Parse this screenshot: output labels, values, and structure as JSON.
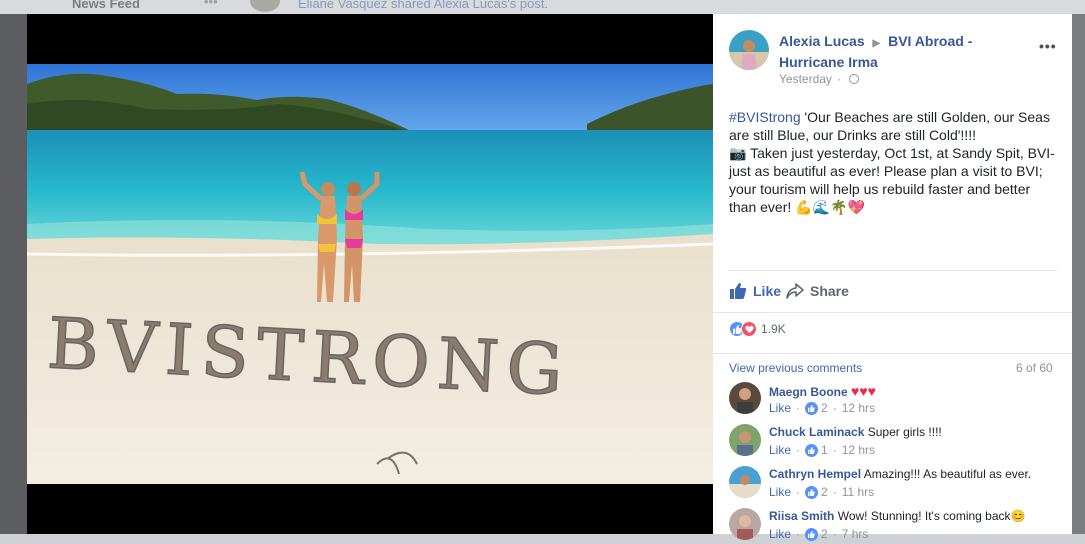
{
  "background": {
    "nav_label": "News Feed",
    "shared_text": "Eliane Vasquez shared Alexia Lucas's post."
  },
  "photo": {
    "sand_text": "BVISTRONG",
    "colors": {
      "sky": "#3f86e0",
      "sea": "#26b6c9",
      "sand": "#efe6d6"
    }
  },
  "post": {
    "author": "Alexia Lucas",
    "group": "BVI Abroad - Hurricane Irma",
    "time": "Yesterday",
    "hashtag": "#BVIStrong",
    "body_1": " 'Our Beaches are still Golden, our Seas are still Blue, our Drinks are still Cold'!!!!",
    "body_2": "📷 Taken just yesterday, Oct 1st, at Sandy Spit, BVI- just as beautiful as ever! Please plan a visit to BVI; your tourism will help us rebuild faster and better than ever! 💪🌊🌴💖",
    "more_label": "•••",
    "like_label": "Like",
    "share_label": "Share",
    "reaction_count": "1.9K"
  },
  "comments_section": {
    "view_previous": "View previous comments",
    "count": "6 of 60",
    "items": [
      {
        "name": "Maegn Boone",
        "text": "",
        "hearts": "♥♥♥",
        "like": "Like",
        "likes": "2",
        "time": "12 hrs"
      },
      {
        "name": "Chuck Laminack",
        "text": "Super girls !!!!",
        "hearts": "",
        "like": "Like",
        "likes": "1",
        "time": "12 hrs"
      },
      {
        "name": "Cathryn Hempel",
        "text": "Amazing!!! As beautiful as ever.",
        "hearts": "",
        "like": "Like",
        "likes": "2",
        "time": "11 hrs"
      },
      {
        "name": "Riisa Smith",
        "text": "Wow! Stunning! It's coming back😊",
        "hearts": "",
        "like": "Like",
        "likes": "2",
        "time": "7 hrs"
      }
    ]
  }
}
